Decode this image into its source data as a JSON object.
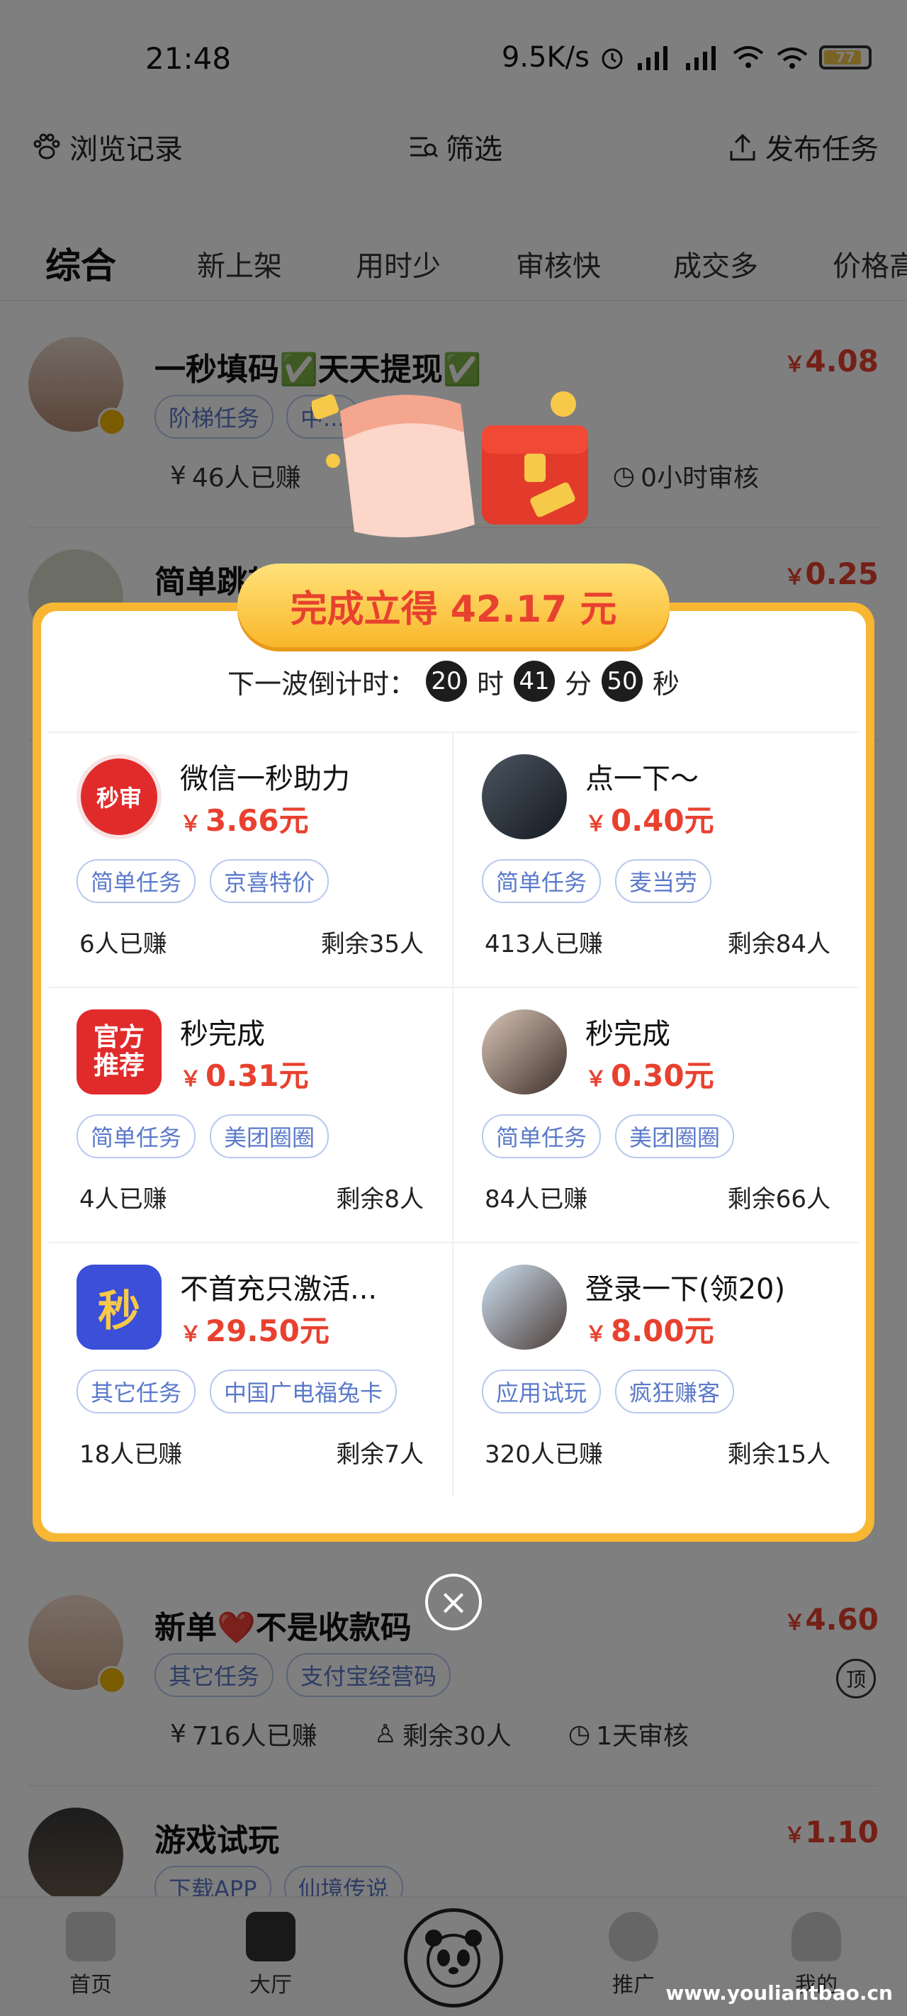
{
  "status_bar": {
    "time": "21:48",
    "net_speed": "9.5K/s",
    "battery": "77"
  },
  "top_bar": {
    "history": "浏览记录",
    "filter": "筛选",
    "publish": "发布任务"
  },
  "tabs": [
    "综合",
    "新上架",
    "用时少",
    "审核快",
    "成交多",
    "价格高"
  ],
  "list": [
    {
      "title": "一秒填码✅天天提现✅",
      "price": "4.08",
      "tags": [
        "阶梯任务",
        "中..."
      ],
      "earned": "46人已赚",
      "review": "0小时审核"
    },
    {
      "title": "简单跳转",
      "price": "0.25"
    },
    {
      "title": "新单❤️不是收款码",
      "price": "4.60",
      "tags": [
        "其它任务",
        "支付宝经营码"
      ],
      "earned": "716人已赚",
      "remain": "剩余30人",
      "review": "1天审核",
      "top": "顶"
    },
    {
      "title": "游戏试玩",
      "price": "1.10",
      "tags": [
        "下载APP",
        "仙境传说"
      ]
    }
  ],
  "currency": "￥",
  "bottom_nav": {
    "home": "首页",
    "hall": "大厅",
    "promote": "推广",
    "mine": "我的"
  },
  "modal": {
    "banner": "完成立得 42.17 元",
    "countdown_label": "下一波倒计时：",
    "hours": "20",
    "hour_unit": "时",
    "minutes": "41",
    "minute_unit": "分",
    "seconds": "50",
    "second_unit": "秒",
    "tasks": [
      {
        "title": "微信一秒助力",
        "price": "3.66元",
        "tags": [
          "简单任务",
          "京喜特价"
        ],
        "earned": "6人已赚",
        "remain": "剩余35人",
        "avatar_text": "秒审"
      },
      {
        "title": "点一下～",
        "price": "0.40元",
        "tags": [
          "简单任务",
          "麦当劳"
        ],
        "earned": "413人已赚",
        "remain": "剩余84人"
      },
      {
        "title": "秒完成",
        "price": "0.31元",
        "tags": [
          "简单任务",
          "美团圈圈"
        ],
        "earned": "4人已赚",
        "remain": "剩余8人",
        "avatar_text": "官方推荐"
      },
      {
        "title": "秒完成",
        "price": "0.30元",
        "tags": [
          "简单任务",
          "美团圈圈"
        ],
        "earned": "84人已赚",
        "remain": "剩余66人"
      },
      {
        "title": "不首充只激活...",
        "price": "29.50元",
        "tags": [
          "其它任务",
          "中国广电福兔卡"
        ],
        "earned": "18人已赚",
        "remain": "剩余7人",
        "avatar_text": "秒"
      },
      {
        "title": "登录一下(领20)",
        "price": "8.00元",
        "tags": [
          "应用试玩",
          "疯狂赚客"
        ],
        "earned": "320人已赚",
        "remain": "剩余15人"
      }
    ]
  },
  "watermark": "www.youliantbao.cn",
  "colors": {
    "accent": "#e8412f",
    "modal_border": "#f7b733",
    "tag": "#5a79c9"
  }
}
